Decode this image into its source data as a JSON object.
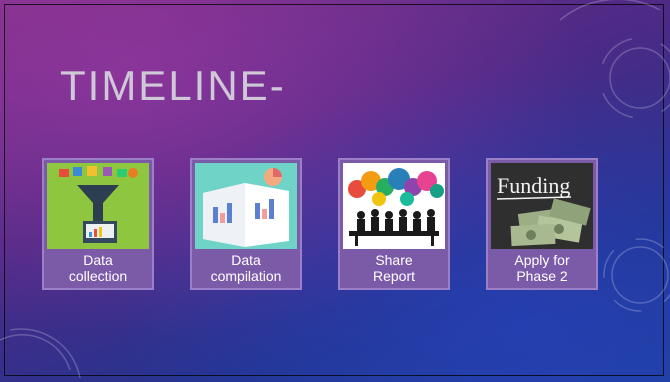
{
  "slide": {
    "title": "TIMELINE-",
    "cards": [
      {
        "line1": "Data",
        "line2": "collection",
        "image": "data-collection-funnel-illustration"
      },
      {
        "line1": "Data",
        "line2": "compilation",
        "image": "data-compilation-book-charts-illustration"
      },
      {
        "line1": "Share",
        "line2": "Report",
        "image": "meeting-speech-bubbles-illustration"
      },
      {
        "line1": "Apply for",
        "line2": "Phase 2",
        "image": "funding-chalkboard-money-illustration",
        "image_text": "Funding"
      }
    ]
  },
  "colors": {
    "background_top": "#7a2f86",
    "background_bottom": "#1e3e9a",
    "card_fill": "#7b5ba8",
    "title_text": "#cfc8d8"
  }
}
